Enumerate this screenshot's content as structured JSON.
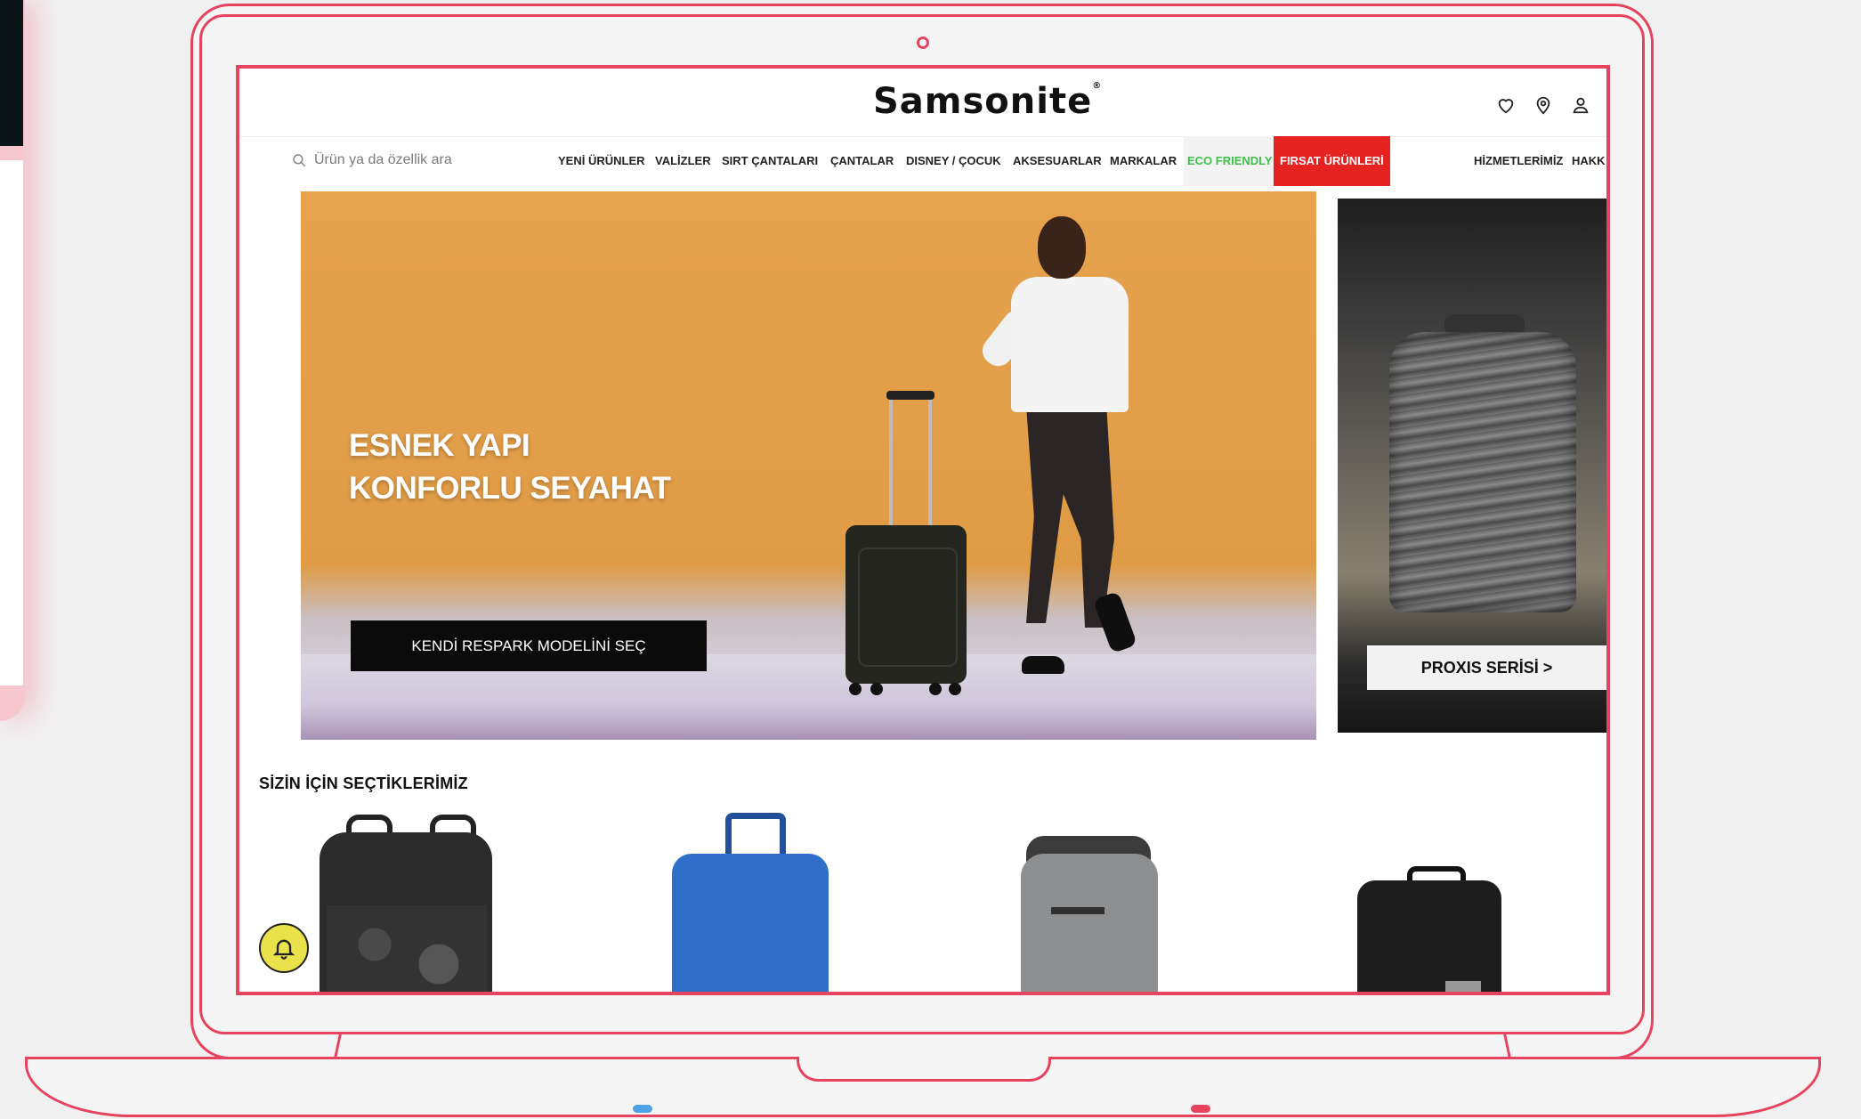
{
  "site": {
    "logo_text": "Samsonite",
    "logo_mark": "®"
  },
  "search": {
    "placeholder": "Ürün ya da özellik ara"
  },
  "nav": {
    "items": [
      {
        "label": "YENİ ÜRÜNLER"
      },
      {
        "label": "VALİZLER"
      },
      {
        "label": "SIRT ÇANTALARI"
      },
      {
        "label": "ÇANTALAR"
      },
      {
        "label": "DISNEY / ÇOCUK"
      },
      {
        "label": "AKSESUARLAR"
      },
      {
        "label": "MARKALAR"
      },
      {
        "label": "ECO FRIENDLY"
      },
      {
        "label": "FIRSAT ÜRÜNLERİ"
      },
      {
        "label": "HİZMETLERİMİZ"
      },
      {
        "label": "HAKK"
      }
    ]
  },
  "header_icons": [
    "heart-icon",
    "location-pin-icon",
    "user-icon"
  ],
  "hero": {
    "title": "ESNEK YAPI\nKONFORLU SEYAHAT",
    "cta_label": "KENDİ RESPARK MODELİNİ SEÇ"
  },
  "promo": {
    "cta_label": "PROXIS SERİSİ >"
  },
  "recommendations": {
    "title": "SİZİN İÇİN SEÇTİKLERİMİZ"
  },
  "colors": {
    "frame": "#e6435f",
    "eco_friendly": "#3fc04a",
    "sale": "#e52421",
    "hero_bg": "#e7a24d",
    "bell": "#e9e24a"
  }
}
